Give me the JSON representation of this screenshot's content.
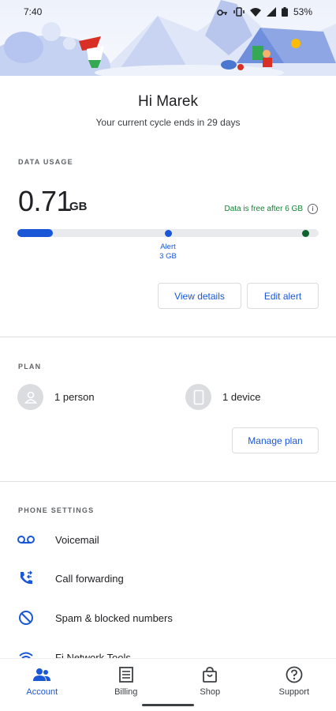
{
  "status_bar": {
    "time": "7:40",
    "battery": "53%"
  },
  "header": {
    "greeting": "Hi Marek",
    "cycle_text": "Your current cycle ends in 29 days"
  },
  "data_usage": {
    "section_label": "DATA USAGE",
    "value": "0.71",
    "unit": "GB",
    "free_note": "Data is free after 6 GB",
    "alert_label": "Alert",
    "alert_amount": "3 GB",
    "usage_fraction": 0.118,
    "alert_fraction": 0.5,
    "free_fraction": 1.0,
    "colors": {
      "usage": "#1a57d6",
      "alert": "#1a57d6",
      "free": "#0d652d"
    },
    "view_details_label": "View details",
    "edit_alert_label": "Edit alert"
  },
  "plan": {
    "section_label": "PLAN",
    "people": "1 person",
    "devices": "1 device",
    "manage_label": "Manage plan"
  },
  "phone_settings": {
    "section_label": "PHONE SETTINGS",
    "items": [
      {
        "label": "Voicemail",
        "icon": "voicemail-icon"
      },
      {
        "label": "Call forwarding",
        "icon": "call-forward-icon"
      },
      {
        "label": "Spam & blocked numbers",
        "icon": "block-icon"
      },
      {
        "label": "Fi Network Tools",
        "icon": "wifi-icon"
      }
    ]
  },
  "bottom_nav": [
    {
      "label": "Account",
      "icon": "account-icon",
      "active": true
    },
    {
      "label": "Billing",
      "icon": "billing-icon",
      "active": false
    },
    {
      "label": "Shop",
      "icon": "shop-icon",
      "active": false
    },
    {
      "label": "Support",
      "icon": "support-icon",
      "active": false
    }
  ]
}
